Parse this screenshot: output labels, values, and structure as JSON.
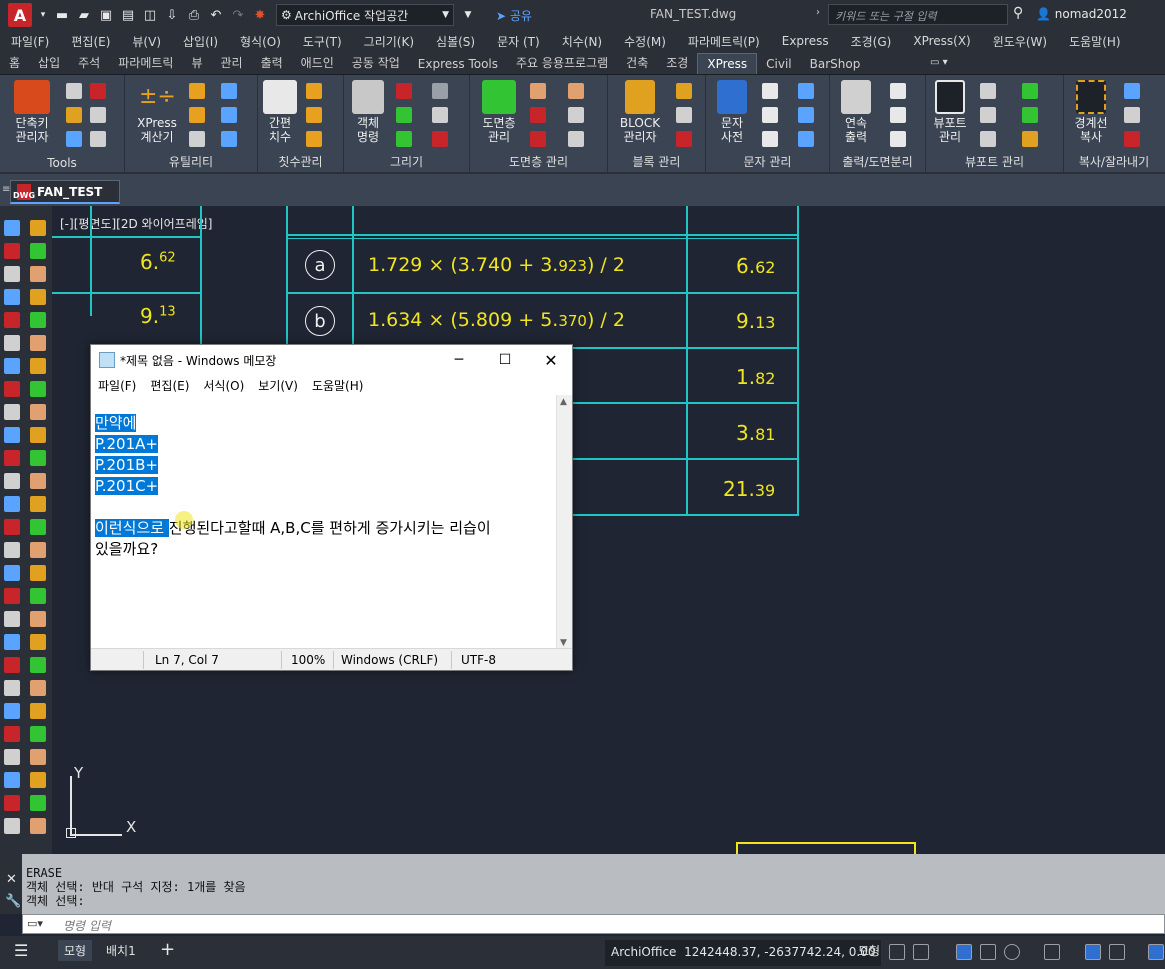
{
  "titlebar": {
    "logo_letter": "A",
    "workspace": "ArchiOffice 작업공간",
    "share": "공유",
    "doc_title": "FAN_TEST.dwg",
    "search_placeholder": "키워드 또는 구절 입력",
    "user": "nomad2012"
  },
  "menubar": [
    "파일(F)",
    "편집(E)",
    "뷰(V)",
    "삽입(I)",
    "형식(O)",
    "도구(T)",
    "그리기(K)",
    "심볼(S)",
    "문자 (T)",
    "치수(N)",
    "수정(M)",
    "파라메트릭(P)",
    "Express",
    "조경(G)",
    "XPress(X)",
    "윈도우(W)",
    "도움말(H)"
  ],
  "ribbon_tabs": [
    "홈",
    "삽입",
    "주석",
    "파라메트릭",
    "뷰",
    "관리",
    "출력",
    "애드인",
    "공동 작업",
    "Express Tools",
    "주요 응용프로그램",
    "건축",
    "조경",
    "XPress",
    "Civil",
    "BarShop"
  ],
  "active_ribbon_tab": "XPress",
  "ribbon": {
    "panels": [
      "Tools",
      "유틸리티",
      "칫수관리",
      "그리기",
      "도면층 관리",
      "블록 관리",
      "문자 관리",
      "출력/도면분리",
      "뷰포트 관리",
      "복사/잘라내기"
    ],
    "buttons": {
      "b1": "단축키\n관리자",
      "b2": "XPress\n계산기",
      "b3": "간편\n치수",
      "b4": "객체\n명령",
      "b5": "도면층\n관리",
      "b6": "BLOCK\n관리자",
      "b7": "문자\n사전",
      "b8": "연속\n출력",
      "b9": "뷰포트\n관리",
      "b10": "경계선\n복사"
    }
  },
  "doc_tab": {
    "label": "FAN_TEST",
    "badge": "DWG"
  },
  "viewport_label": "[-][평면도][2D 와이어프레임]",
  "drawing": {
    "left_values": [
      {
        "main": "6.",
        "sup": "62"
      },
      {
        "main": "9.",
        "sup": "13"
      }
    ],
    "rows": [
      {
        "mark": "a",
        "formula_a": "1.729 × (3.740 + 3.",
        "formula_b": "923",
        "formula_c": ") / 2",
        "area_main": "6.",
        "area_dec": "62"
      },
      {
        "mark": "b",
        "formula_a": "1.634 × (5.809 + 5.",
        "formula_b": "370",
        "formula_c": ") / 2",
        "area_main": "9.",
        "area_dec": "13"
      }
    ],
    "extra_areas": [
      {
        "main": "1.",
        "dec": "82"
      },
      {
        "main": "3.",
        "dec": "81"
      },
      {
        "main": "21.",
        "dec": "39"
      }
    ],
    "ucs": {
      "x": "X",
      "y": "Y"
    }
  },
  "notepad": {
    "title": "*제목 없음 - Windows 메모장",
    "menu": [
      "파일(F)",
      "편집(E)",
      "서식(O)",
      "보기(V)",
      "도움말(H)"
    ],
    "lines_selected": [
      "만약에",
      "P.201A+",
      "P.201B+",
      "P.201C+"
    ],
    "q_selected": "이런식으로 ",
    "q_rest_line1": "진행된다고할때 A,B,C를 편하게 증가시키는 리습이",
    "q_line2": "있을까요?",
    "status": {
      "pos": "Ln 7, Col 7",
      "zoom": "100%",
      "eol": "Windows (CRLF)",
      "enc": "UTF-8"
    }
  },
  "command": {
    "history": [
      "ERASE",
      "객체 선택: 반대 구석 지정: 1개를 찾음",
      "객체 선택:"
    ],
    "placeholder": "명령 입력"
  },
  "statusbar": {
    "tab_model": "모형",
    "tab_layout": "배치1",
    "app": "ArchiOffice",
    "coords": "1242448.37, -2637742.24, 0.00",
    "model_btn": "모형"
  },
  "colors": {
    "accent": "#5aa4ff",
    "table_line": "#22c4c4",
    "drawing_text": "#f0e51e",
    "selection": "#0078d7"
  }
}
